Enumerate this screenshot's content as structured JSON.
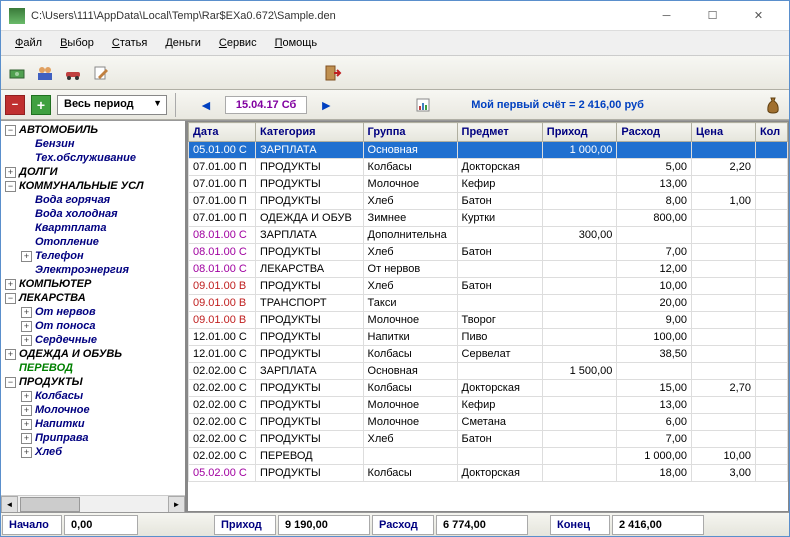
{
  "title": "C:\\Users\\111\\AppData\\Local\\Temp\\Rar$EXa0.672\\Sample.den",
  "menu": [
    "Файл",
    "Выбор",
    "Статья",
    "Деньги",
    "Сервис",
    "Помощь"
  ],
  "period": "Весь период",
  "date": "15.04.17 Сб",
  "account_label": "Мой первый счёт = 2 416,00 руб",
  "cols": [
    "Дата",
    "Категория",
    "Группа",
    "Предмет",
    "Приход",
    "Расход",
    "Цена",
    "Кол"
  ],
  "tree": [
    {
      "label": "АВТОМОБИЛЬ",
      "exp": "-",
      "children": [
        {
          "label": "Бензин"
        },
        {
          "label": "Тех.обслуживание"
        }
      ]
    },
    {
      "label": "ДОЛГИ",
      "exp": "+"
    },
    {
      "label": "КОММУНАЛЬНЫЕ УСЛ",
      "exp": "-",
      "children": [
        {
          "label": "Вода горячая"
        },
        {
          "label": "Вода холодная"
        },
        {
          "label": "Квартплата"
        },
        {
          "label": "Отопление"
        },
        {
          "label": "Телефон",
          "exp": "+"
        },
        {
          "label": "Электроэнергия"
        }
      ]
    },
    {
      "label": "КОМПЬЮТЕР",
      "exp": "+"
    },
    {
      "label": "ЛЕКАРСТВА",
      "exp": "-",
      "children": [
        {
          "label": "От нервов",
          "exp": "+"
        },
        {
          "label": "От поноса",
          "exp": "+"
        },
        {
          "label": "Сердечные",
          "exp": "+"
        }
      ]
    },
    {
      "label": "ОДЕЖДА И ОБУВЬ",
      "exp": "+"
    },
    {
      "label": "ПЕРЕВОД",
      "green": true
    },
    {
      "label": "ПРОДУКТЫ",
      "exp": "-",
      "children": [
        {
          "label": "Колбасы",
          "exp": "+"
        },
        {
          "label": "Молочное",
          "exp": "+"
        },
        {
          "label": "Напитки",
          "exp": "+"
        },
        {
          "label": "Приправа",
          "exp": "+"
        },
        {
          "label": "Хлеб",
          "exp": "+"
        }
      ]
    }
  ],
  "rows": [
    {
      "date": "05.01.00",
      "dd": "С",
      "dt": "",
      "cat": "ЗАРПЛАТА",
      "grp": "Основная",
      "item": "",
      "in": "1 000,00",
      "out": "",
      "price": "",
      "sel": true
    },
    {
      "date": "07.01.00",
      "dd": "П",
      "dt": "",
      "cat": "ПРОДУКТЫ",
      "grp": "Колбасы",
      "item": "Докторская",
      "in": "",
      "out": "5,00",
      "price": "2,20"
    },
    {
      "date": "07.01.00",
      "dd": "П",
      "dt": "",
      "cat": "ПРОДУКТЫ",
      "grp": "Молочное",
      "item": "Кефир",
      "in": "",
      "out": "13,00",
      "price": ""
    },
    {
      "date": "07.01.00",
      "dd": "П",
      "dt": "",
      "cat": "ПРОДУКТЫ",
      "grp": "Хлеб",
      "item": "Батон",
      "in": "",
      "out": "8,00",
      "price": "1,00"
    },
    {
      "date": "07.01.00",
      "dd": "П",
      "dt": "",
      "cat": "ОДЕЖДА И ОБУВ",
      "grp": "Зимнее",
      "item": "Куртки",
      "in": "",
      "out": "800,00",
      "price": ""
    },
    {
      "date": "08.01.00",
      "dd": "С",
      "dt": "sat",
      "cat": "ЗАРПЛАТА",
      "grp": "Дополнительна",
      "item": "",
      "in": "300,00",
      "out": "",
      "price": ""
    },
    {
      "date": "08.01.00",
      "dd": "С",
      "dt": "sat",
      "cat": "ПРОДУКТЫ",
      "grp": "Хлеб",
      "item": "Батон",
      "in": "",
      "out": "7,00",
      "price": ""
    },
    {
      "date": "08.01.00",
      "dd": "С",
      "dt": "sat",
      "cat": "ЛЕКАРСТВА",
      "grp": "От нервов",
      "item": "",
      "in": "",
      "out": "12,00",
      "price": ""
    },
    {
      "date": "09.01.00",
      "dd": "В",
      "dt": "sun",
      "cat": "ПРОДУКТЫ",
      "grp": "Хлеб",
      "item": "Батон",
      "in": "",
      "out": "10,00",
      "price": ""
    },
    {
      "date": "09.01.00",
      "dd": "В",
      "dt": "sun",
      "cat": "ТРАНСПОРТ",
      "grp": "Такси",
      "item": "",
      "in": "",
      "out": "20,00",
      "price": ""
    },
    {
      "date": "09.01.00",
      "dd": "В",
      "dt": "sun",
      "cat": "ПРОДУКТЫ",
      "grp": "Молочное",
      "item": "Творог",
      "in": "",
      "out": "9,00",
      "price": ""
    },
    {
      "date": "12.01.00",
      "dd": "С",
      "dt": "",
      "cat": "ПРОДУКТЫ",
      "grp": "Напитки",
      "item": "Пиво",
      "in": "",
      "out": "100,00",
      "price": ""
    },
    {
      "date": "12.01.00",
      "dd": "С",
      "dt": "",
      "cat": "ПРОДУКТЫ",
      "grp": "Колбасы",
      "item": "Сервелат",
      "in": "",
      "out": "38,50",
      "price": ""
    },
    {
      "date": "02.02.00",
      "dd": "С",
      "dt": "",
      "cat": "ЗАРПЛАТА",
      "grp": "Основная",
      "item": "",
      "in": "1 500,00",
      "out": "",
      "price": ""
    },
    {
      "date": "02.02.00",
      "dd": "С",
      "dt": "",
      "cat": "ПРОДУКТЫ",
      "grp": "Колбасы",
      "item": "Докторская",
      "in": "",
      "out": "15,00",
      "price": "2,70"
    },
    {
      "date": "02.02.00",
      "dd": "С",
      "dt": "",
      "cat": "ПРОДУКТЫ",
      "grp": "Молочное",
      "item": "Кефир",
      "in": "",
      "out": "13,00",
      "price": ""
    },
    {
      "date": "02.02.00",
      "dd": "С",
      "dt": "",
      "cat": "ПРОДУКТЫ",
      "grp": "Молочное",
      "item": "Сметана",
      "in": "",
      "out": "6,00",
      "price": ""
    },
    {
      "date": "02.02.00",
      "dd": "С",
      "dt": "",
      "cat": "ПРОДУКТЫ",
      "grp": "Хлеб",
      "item": "Батон",
      "in": "",
      "out": "7,00",
      "price": ""
    },
    {
      "date": "02.02.00",
      "dd": "С",
      "dt": "",
      "cat": "ПЕРЕВОД",
      "grp": "",
      "item": "",
      "in": "",
      "out": "1 000,00",
      "price": "10,00"
    },
    {
      "date": "05.02.00",
      "dd": "С",
      "dt": "sat",
      "cat": "ПРОДУКТЫ",
      "grp": "Колбасы",
      "item": "Докторская",
      "in": "",
      "out": "18,00",
      "price": "3,00"
    }
  ],
  "status": {
    "start_lbl": "Начало",
    "start_val": "0,00",
    "in_lbl": "Приход",
    "in_val": "9 190,00",
    "out_lbl": "Расход",
    "out_val": "6 774,00",
    "end_lbl": "Конец",
    "end_val": "2 416,00"
  }
}
